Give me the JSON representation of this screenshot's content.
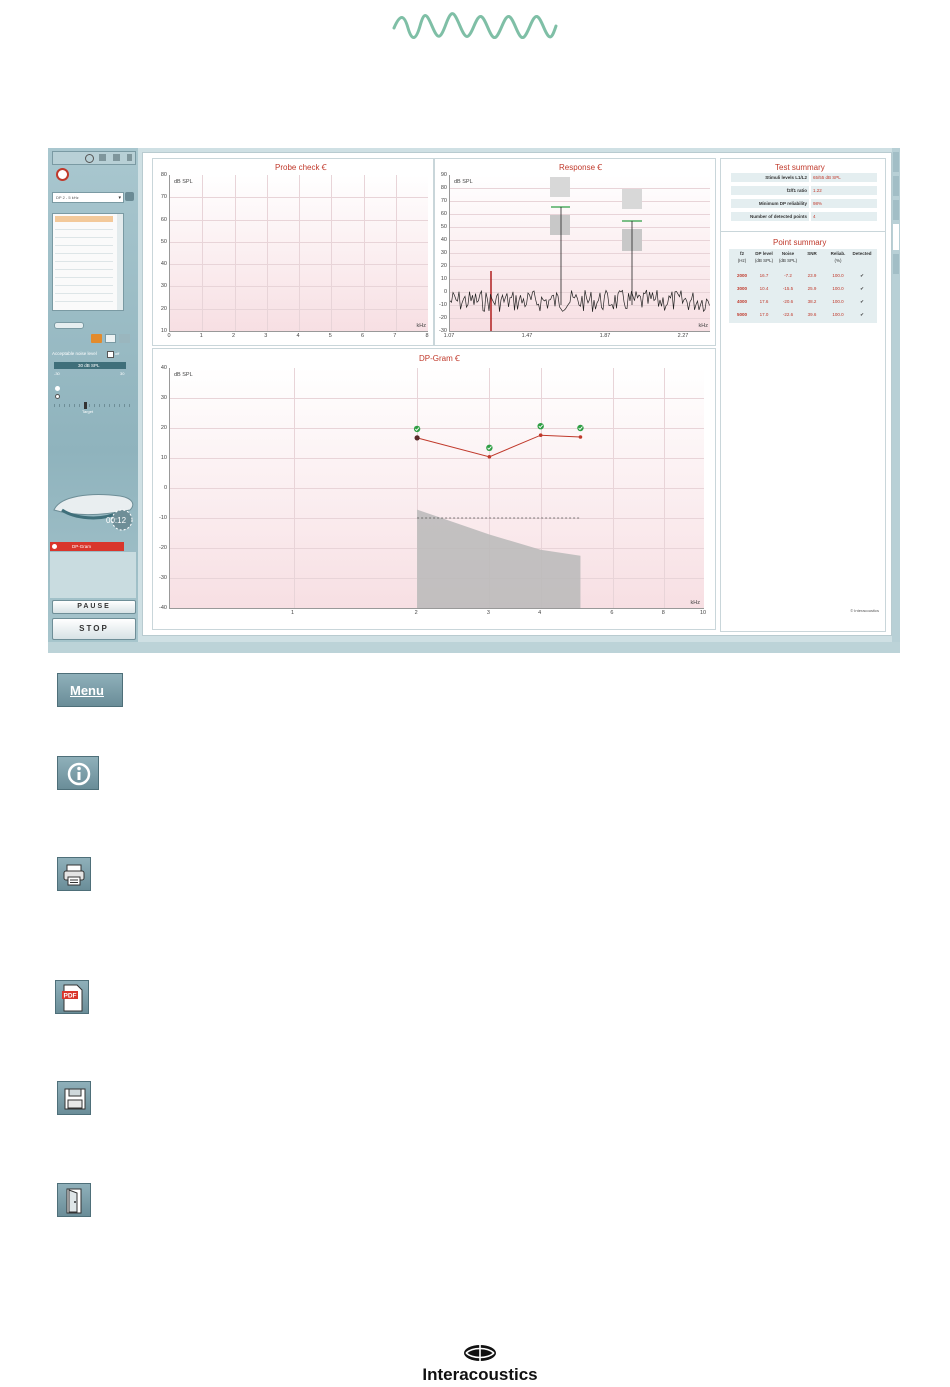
{
  "app": {
    "sidebar": {
      "protocol": "DP 2 - 5 kHz",
      "noise_label": "Acceptable noise level",
      "noise_off": "off",
      "noise_value": "30 dB SPL",
      "noise_min": "-30",
      "noise_max": "30",
      "target_label": "Target",
      "timer": "00:12",
      "test_item": "DP-Gram",
      "pause_label": "PAUSE",
      "stop_label": "STOP"
    },
    "probe_check": {
      "title": "Probe check",
      "unit": "dB SPL",
      "x_unit": "kHz",
      "y_ticks": [
        "80",
        "70",
        "60",
        "50",
        "40",
        "30",
        "20",
        "10"
      ],
      "x_ticks": [
        "0",
        "1",
        "2",
        "3",
        "4",
        "5",
        "6",
        "7",
        "8"
      ]
    },
    "response": {
      "title": "Response",
      "unit": "dB SPL",
      "x_unit": "kHz",
      "y_ticks": [
        "90",
        "80",
        "70",
        "60",
        "50",
        "40",
        "30",
        "20",
        "10",
        "0",
        "-10",
        "-20",
        "-30"
      ],
      "x_ticks": [
        "1.07",
        "1.47",
        "1.87",
        "2.27"
      ]
    },
    "dpgram": {
      "title": "DP-Gram",
      "unit": "dB SPL",
      "x_unit": "kHz",
      "y_ticks": [
        "40",
        "30",
        "20",
        "10",
        "0",
        "-10",
        "-20",
        "-30",
        "-40"
      ],
      "x_ticks": [
        "1",
        "2",
        "3",
        "4",
        "6",
        "8",
        "10"
      ]
    },
    "test_summary": {
      "title": "Test summary",
      "rows": [
        {
          "label": "Stimuli levels L1/L2",
          "value": "65/55 dB SPL"
        },
        {
          "label": "f2/f1 ratio",
          "value": "1.22"
        },
        {
          "label": "Minimum DP reliability",
          "value": "98%"
        },
        {
          "label": "Number of detected points",
          "value": "4"
        }
      ]
    },
    "point_summary": {
      "title": "Point summary",
      "headers": [
        "f2",
        "DP level",
        "Noise",
        "SNR",
        "Reliab.",
        "Detected"
      ],
      "units": [
        "(Hz)",
        "(dB SPL)",
        "(dB SPL)",
        "",
        "(%)",
        ""
      ],
      "rows": [
        [
          "2000",
          "16.7",
          "-7.2",
          "23.9",
          "100.0",
          "✔"
        ],
        [
          "3000",
          "10.4",
          "-15.5",
          "25.9",
          "100.0",
          "✔"
        ],
        [
          "4000",
          "17.6",
          "-20.6",
          "38.2",
          "100.0",
          "✔"
        ],
        [
          "5000",
          "17.0",
          "-22.6",
          "39.6",
          "100.0",
          "✔"
        ]
      ]
    },
    "copyright": "© Interacoustics"
  },
  "chart_data": {
    "type": "line",
    "title": "DP-Gram",
    "ylabel": "dB SPL",
    "xlabel": "kHz",
    "x_scale": "log",
    "xlim": [
      0.5,
      10
    ],
    "ylim": [
      -40,
      40
    ],
    "series": [
      {
        "name": "DP level",
        "x": [
          2,
          3,
          4,
          5
        ],
        "values": [
          16.7,
          10.4,
          17.6,
          17.0
        ],
        "color": "#c0392b"
      },
      {
        "name": "Noise",
        "x": [
          2,
          3,
          4,
          5
        ],
        "values": [
          -7.2,
          -15.5,
          -20.6,
          -22.6
        ],
        "color": "#b8b8b8"
      }
    ],
    "reference_line": -10
  },
  "toolbar": {
    "menu_label": "Menu"
  },
  "brand": {
    "name": "Interacoustics"
  },
  "colors": {
    "accent": "#c0392b",
    "teal": "#8fb3bd",
    "wave": "#7fbfa6"
  }
}
